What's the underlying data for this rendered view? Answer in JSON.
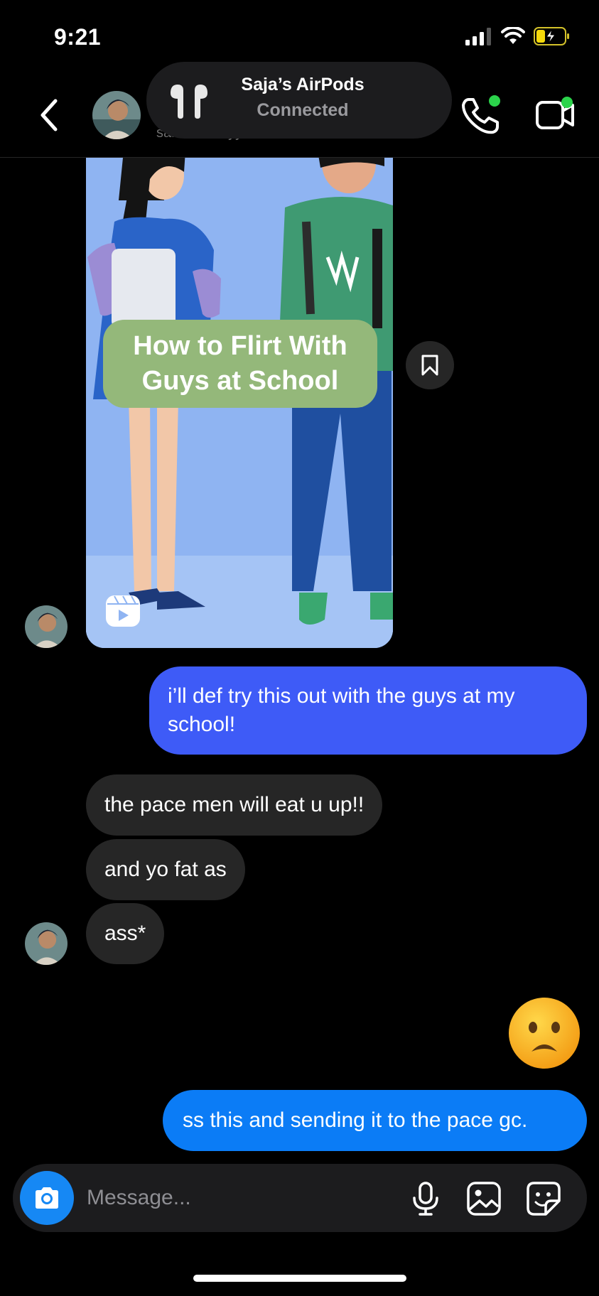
{
  "status_bar": {
    "time": "9:21"
  },
  "header": {
    "username": "sarahhanaryy",
    "airpods": {
      "title": "Saja’s AirPods",
      "subtitle": "Connected"
    }
  },
  "reel": {
    "caption": "How to Flirt With\nGuys at School"
  },
  "messages": [
    {
      "id": "m1",
      "direction": "outgoing",
      "text": "i’ll def try this out with the guys at my school!"
    },
    {
      "id": "m2",
      "direction": "incoming",
      "text": "the pace men will eat u up!!"
    },
    {
      "id": "m3",
      "direction": "incoming",
      "text": "and yo fat as"
    },
    {
      "id": "m4",
      "direction": "incoming",
      "text": "ass*"
    },
    {
      "id": "m5",
      "direction": "outgoing",
      "emoji": "frowning-face"
    },
    {
      "id": "m6",
      "direction": "outgoing",
      "text": "ss this and sending it to the pace gc."
    }
  ],
  "composer": {
    "placeholder": "Message..."
  },
  "colors": {
    "background": "#000000",
    "incoming_bubble": "#262626",
    "outgoing_bubble_1": "#3e5bf7",
    "outgoing_bubble_2": "#0b7cf6",
    "camera_button": "#1688f4",
    "online_dot": "#2bd34b"
  }
}
